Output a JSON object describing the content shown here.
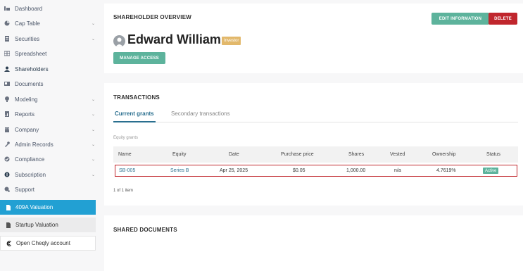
{
  "sidebar": {
    "items": [
      {
        "label": "Dashboard",
        "icon": "dashboard-icon",
        "has_chevron": false
      },
      {
        "label": "Cap Table",
        "icon": "cap-table-icon",
        "has_chevron": true
      },
      {
        "label": "Securities",
        "icon": "securities-icon",
        "has_chevron": true
      },
      {
        "label": "Spreadsheet",
        "icon": "spreadsheet-icon",
        "has_chevron": false
      },
      {
        "label": "Shareholders",
        "icon": "shareholders-icon",
        "has_chevron": false
      },
      {
        "label": "Documents",
        "icon": "documents-icon",
        "has_chevron": false
      },
      {
        "label": "Modeling",
        "icon": "modeling-icon",
        "has_chevron": true
      },
      {
        "label": "Reports",
        "icon": "reports-icon",
        "has_chevron": true
      },
      {
        "label": "Company",
        "icon": "company-icon",
        "has_chevron": true
      },
      {
        "label": "Admin Records",
        "icon": "admin-records-icon",
        "has_chevron": true
      },
      {
        "label": "Compliance",
        "icon": "compliance-icon",
        "has_chevron": true
      },
      {
        "label": "Subscription",
        "icon": "subscription-icon",
        "has_chevron": true
      },
      {
        "label": "Support",
        "icon": "support-icon",
        "has_chevron": false
      }
    ],
    "valuation_409a": "409A Valuation",
    "startup_valuation": "Startup Valuation",
    "open_cheqly": "Open Cheqly account"
  },
  "overview": {
    "title": "SHAREHOLDER OVERVIEW",
    "edit_label": "EDIT INFORMATION",
    "delete_label": "DELETE",
    "name": "Edward William",
    "badge": "Investor",
    "manage_access_label": "MANAGE ACCESS"
  },
  "transactions": {
    "title": "TRANSACTIONS",
    "tab_current": "Current grants",
    "tab_secondary": "Secondary transactions",
    "section_label": "Equity grants",
    "headers": [
      "Name",
      "Equity",
      "Date",
      "Purchase price",
      "Shares",
      "Vested",
      "Ownership",
      "Status"
    ],
    "row": {
      "name": "SB-005",
      "equity": "Series B",
      "date": "Apr 25, 2025",
      "purchase_price": "$0.05",
      "shares": "1,000.00",
      "vested": "n/a",
      "ownership": "4.7619%",
      "status": "Active"
    },
    "paging": "1 of 1 item"
  },
  "shared_documents": {
    "title": "SHARED DOCUMENTS"
  },
  "colors": {
    "accent_green": "#5db39c",
    "danger_red": "#c0262d",
    "active_blue": "#22a0d3",
    "link_blue": "#2a6f8f",
    "investor_badge": "#e2b86b"
  }
}
